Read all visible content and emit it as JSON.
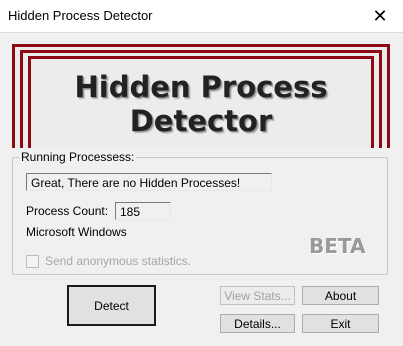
{
  "window": {
    "title": "Hidden Process Detector",
    "close_glyph": "✕"
  },
  "banner": {
    "title": "Hidden Process Detector",
    "accent_color": "#8b0a16"
  },
  "group": {
    "label": "Running Processess:",
    "status_text": "Great, There are no Hidden Processes!",
    "process_count_label": "Process Count:",
    "process_count_value": "185",
    "os_label": "Microsoft Windows",
    "beta_label": "BETA",
    "send_stats_label": "Send anonymous statistics.",
    "send_stats_checked": false
  },
  "buttons": {
    "detect": "Detect",
    "view_stats": "View Stats...",
    "about": "About",
    "details": "Details...",
    "exit": "Exit"
  }
}
